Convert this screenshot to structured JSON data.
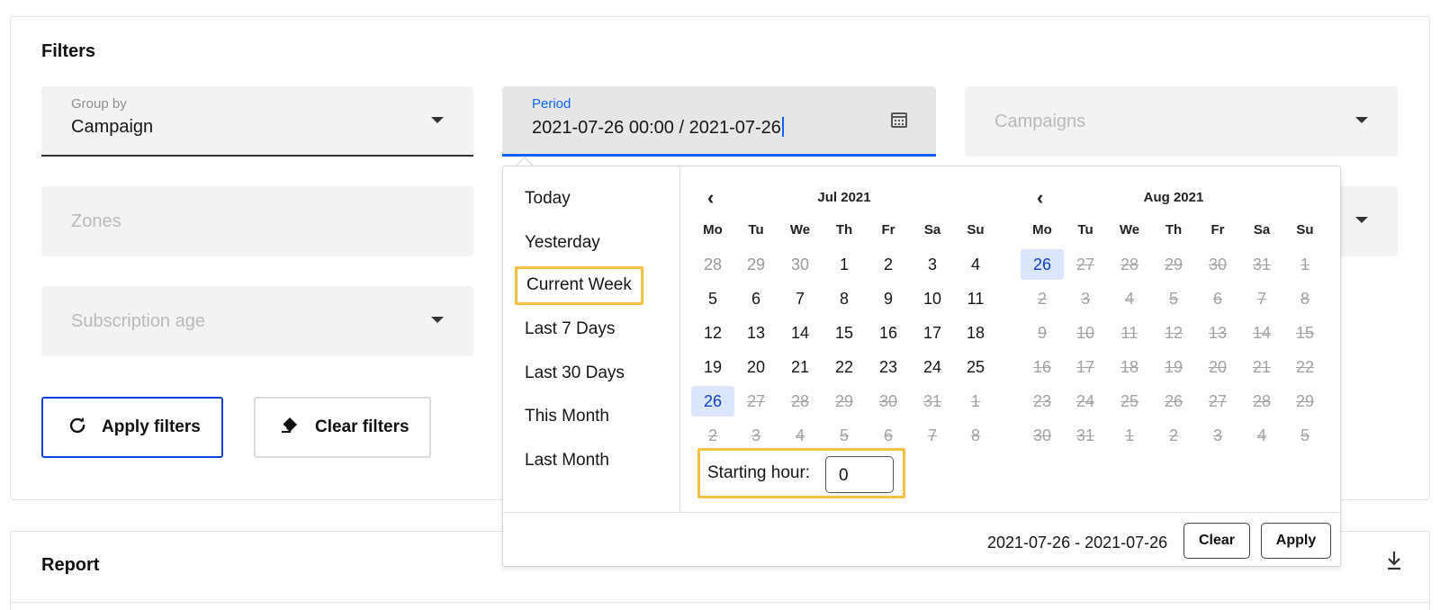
{
  "filters": {
    "title": "Filters",
    "group_by": {
      "label": "Group by",
      "value": "Campaign"
    },
    "period": {
      "label": "Period",
      "value": "2021-07-26 00:00 / 2021-07-26"
    },
    "campaigns": {
      "placeholder": "Campaigns"
    },
    "zones": {
      "placeholder": "Zones"
    },
    "subscription_age": {
      "placeholder": "Subscription age"
    },
    "apply_button": {
      "label": "Apply filters",
      "icon": "refresh-icon"
    },
    "clear_button": {
      "label": "Clear filters",
      "icon": "eraser-icon"
    }
  },
  "datepicker": {
    "presets": [
      "Today",
      "Yesterday",
      "Current Week",
      "Last 7 Days",
      "Last 30 Days",
      "This Month",
      "Last Month"
    ],
    "highlighted_preset": "Current Week",
    "weekdays": [
      "Mo",
      "Tu",
      "We",
      "Th",
      "Fr",
      "Sa",
      "Su"
    ],
    "months": [
      {
        "title": "Jul 2021",
        "weeks": [
          [
            "28",
            "29",
            "30",
            "1",
            "2",
            "3",
            "4"
          ],
          [
            "5",
            "6",
            "7",
            "8",
            "9",
            "10",
            "11"
          ],
          [
            "12",
            "13",
            "14",
            "15",
            "16",
            "17",
            "18"
          ],
          [
            "19",
            "20",
            "21",
            "22",
            "23",
            "24",
            "25"
          ],
          [
            "26",
            "27",
            "28",
            "29",
            "30",
            "31",
            "1"
          ],
          [
            "2",
            "3",
            "4",
            "5",
            "6",
            "7",
            "8"
          ]
        ]
      },
      {
        "title": "Aug 2021",
        "weeks": [
          [
            "26",
            "27",
            "28",
            "29",
            "30",
            "31",
            "1"
          ],
          [
            "2",
            "3",
            "4",
            "5",
            "6",
            "7",
            "8"
          ],
          [
            "9",
            "10",
            "11",
            "12",
            "13",
            "14",
            "15"
          ],
          [
            "16",
            "17",
            "18",
            "19",
            "20",
            "21",
            "22"
          ],
          [
            "23",
            "24",
            "25",
            "26",
            "27",
            "28",
            "29"
          ],
          [
            "30",
            "31",
            "1",
            "2",
            "3",
            "4",
            "5"
          ]
        ]
      }
    ],
    "starting_hour": {
      "label": "Starting hour:",
      "value": "0"
    },
    "range_text": "2021-07-26 - 2021-07-26",
    "clear_label": "Clear",
    "apply_label": "Apply"
  },
  "report": {
    "title": "Report"
  },
  "colors": {
    "accent": "#0f62fe",
    "selected_bg": "#dbe5fb",
    "highlight": "#f6c142"
  }
}
